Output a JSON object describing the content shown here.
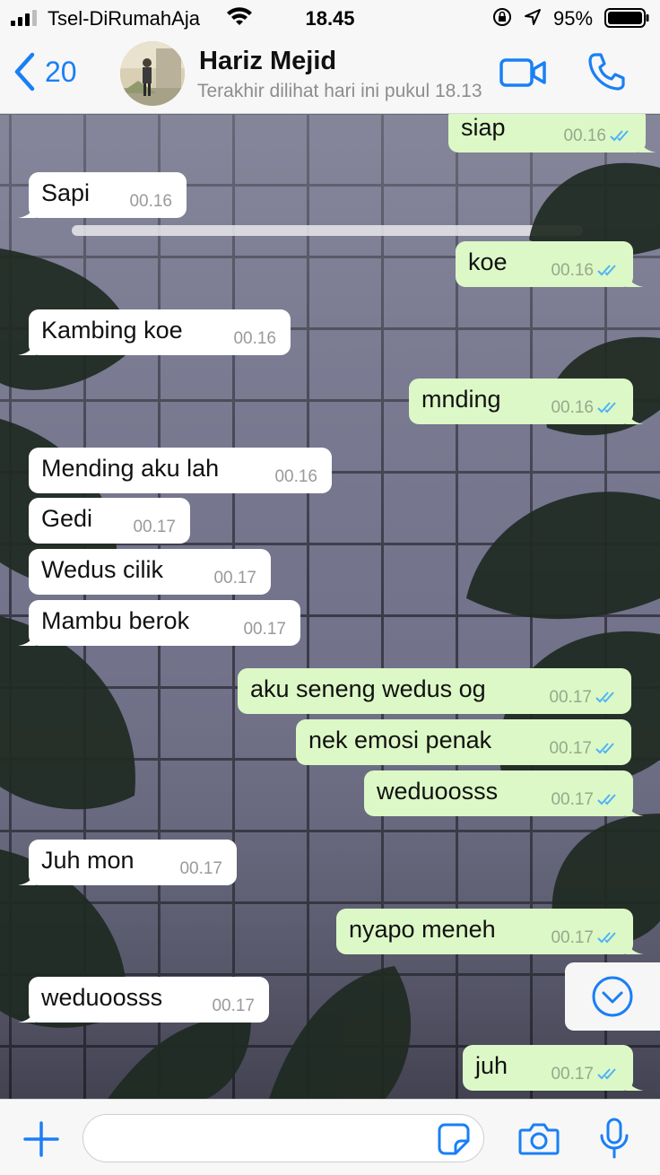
{
  "status_bar": {
    "carrier": "Tsel-DiRumahAja",
    "time": "18.45",
    "battery": "95%"
  },
  "header": {
    "back_count": "20",
    "contact_name": "Hariz Mejid",
    "last_seen": "Terakhir dilihat hari ini pukul 18.13"
  },
  "colors": {
    "accent": "#1a7ff5",
    "outgoing_bubble": "#dcf8c6",
    "incoming_bubble": "#ffffff",
    "read_ticks": "#4fb3f6"
  },
  "messages": [
    {
      "text": "siap",
      "time": "00.16",
      "direction": "out",
      "read": true
    },
    {
      "text": "Sapi",
      "time": "00.16",
      "direction": "in"
    },
    {
      "text": "koe",
      "time": "00.16",
      "direction": "out",
      "read": true
    },
    {
      "text": "Kambing koe",
      "time": "00.16",
      "direction": "in"
    },
    {
      "text": "mnding",
      "time": "00.16",
      "direction": "out",
      "read": true
    },
    {
      "text": "Mending aku lah",
      "time": "00.16",
      "direction": "in"
    },
    {
      "text": "Gedi",
      "time": "00.17",
      "direction": "in"
    },
    {
      "text": "Wedus cilik",
      "time": "00.17",
      "direction": "in"
    },
    {
      "text": "Mambu berok",
      "time": "00.17",
      "direction": "in"
    },
    {
      "text": "aku seneng wedus og",
      "time": "00.17",
      "direction": "out",
      "read": true
    },
    {
      "text": "nek emosi penak",
      "time": "00.17",
      "direction": "out",
      "read": true
    },
    {
      "text": "weduoosss",
      "time": "00.17",
      "direction": "out",
      "read": true
    },
    {
      "text": "Juh mon",
      "time": "00.17",
      "direction": "in"
    },
    {
      "text": "nyapo meneh",
      "time": "00.17",
      "direction": "out",
      "read": true
    },
    {
      "text": "weduoosss",
      "time": "00.17",
      "direction": "in"
    },
    {
      "text": "juh",
      "time": "00.17",
      "direction": "out",
      "read": true
    }
  ],
  "input": {
    "value": "",
    "placeholder": ""
  },
  "icons": {
    "back": "chevron-left-icon",
    "video": "video-camera-icon",
    "call": "phone-icon",
    "scroll": "chevron-down-circle-icon",
    "attach": "plus-icon",
    "sticker": "sticker-icon",
    "camera": "camera-icon",
    "mic": "microphone-icon"
  }
}
